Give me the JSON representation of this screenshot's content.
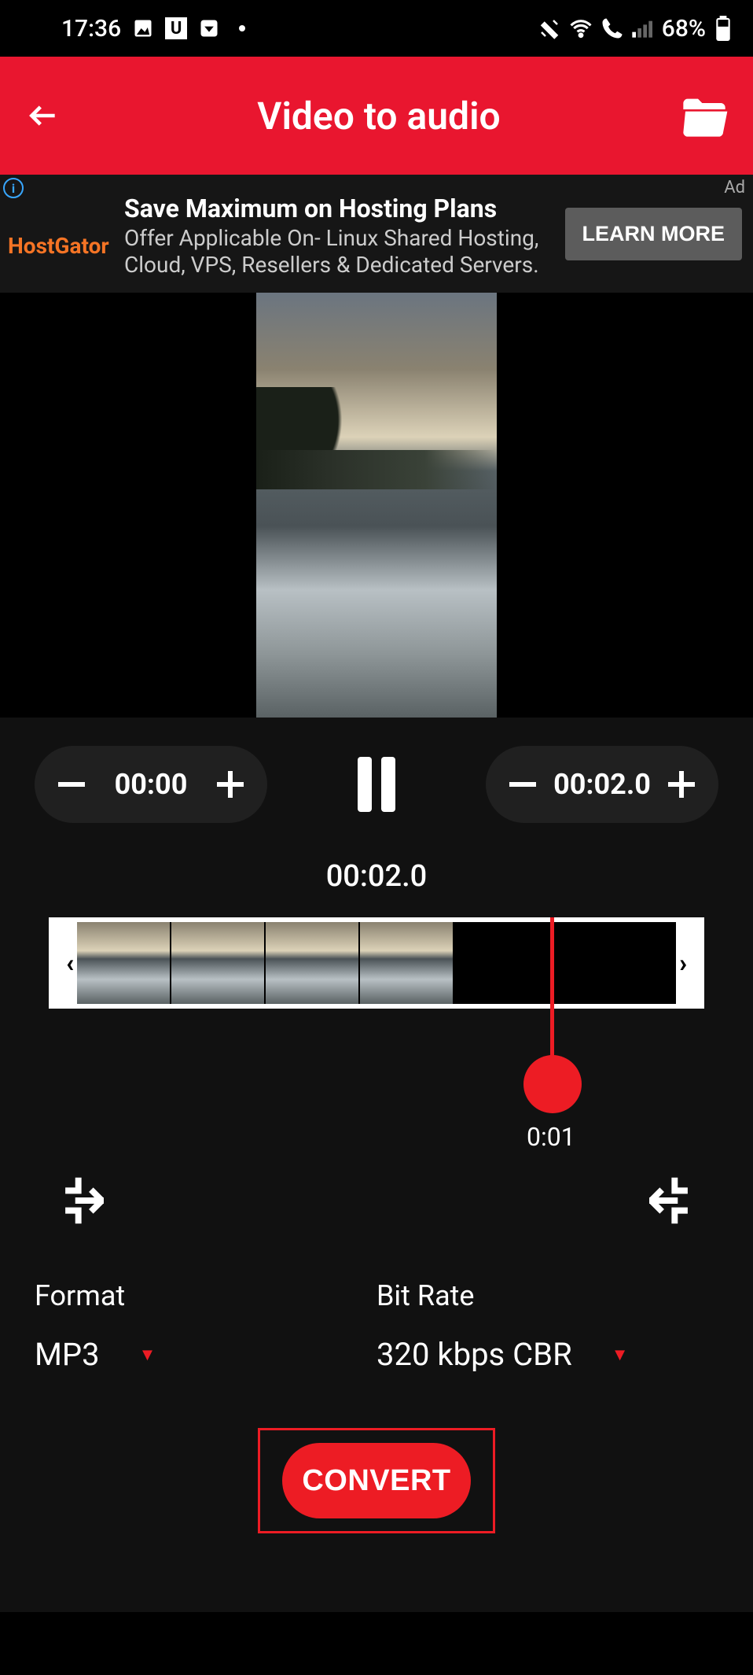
{
  "status": {
    "time": "17:36",
    "battery": "68%"
  },
  "header": {
    "title": "Video to audio"
  },
  "ad": {
    "label": "Ad",
    "logo": "HostGator",
    "headline": "Save Maximum on Hosting Plans",
    "body": "Offer Applicable On- Linux Shared Hosting, Cloud, VPS, Resellers & Dedicated Servers.",
    "button": "LEARN MORE"
  },
  "controls": {
    "start_time": "00:00",
    "end_time": "00:02.0",
    "current_time": "00:02.0",
    "playhead_label": "0:01"
  },
  "options": {
    "format_label": "Format",
    "format_value": "MP3",
    "bitrate_label": "Bit Rate",
    "bitrate_value": "320 kbps CBR"
  },
  "convert": {
    "label": "CONVERT"
  }
}
